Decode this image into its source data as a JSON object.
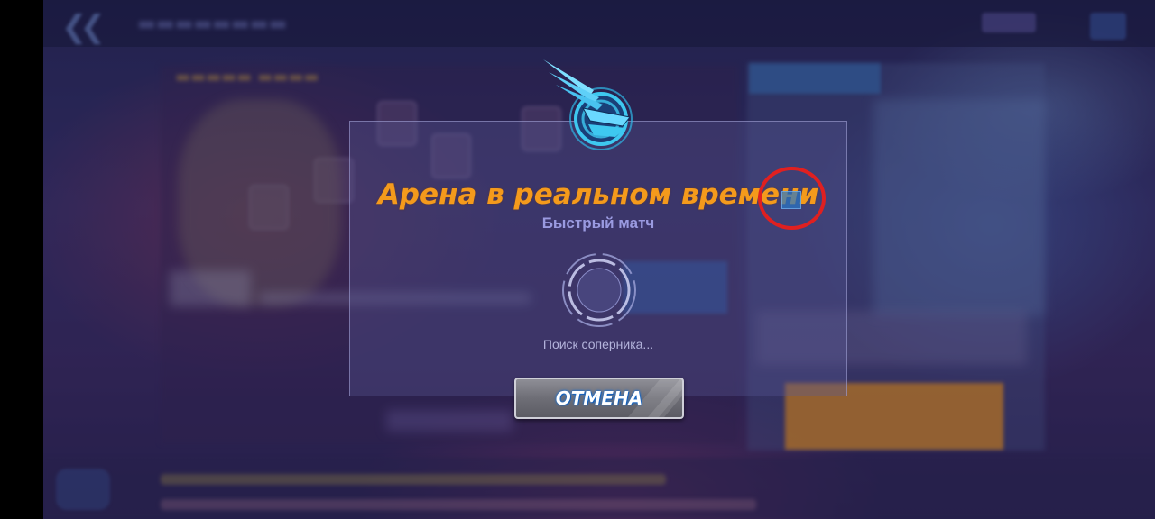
{
  "dialog": {
    "title": "Арена в реальном времени",
    "subtitle": "Быстрый матч",
    "status_text": "Поиск соперника...",
    "cancel_label": "ОТМЕНА"
  },
  "colors": {
    "title": "#f49a1c",
    "subtitle": "#9a9ae0",
    "emblem_cyan": "#3ec8f0",
    "highlight_circle": "#e02020",
    "cancel_glow": "#1a6fd0"
  },
  "icons": {
    "emblem": "winged-arena-emblem-icon",
    "spinner": "loading-ring-icon",
    "back": "double-chevron-left-icon"
  }
}
